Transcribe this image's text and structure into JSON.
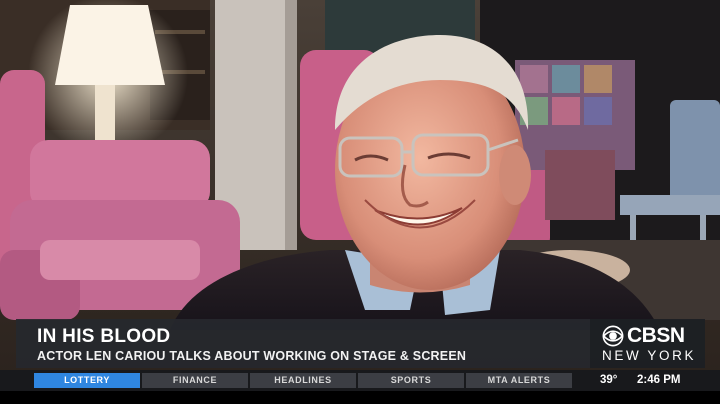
{
  "lower_third": {
    "headline": "IN HIS BLOOD",
    "subhead": "ACTOR LEN CARIOU TALKS ABOUT WORKING ON STAGE & SCREEN"
  },
  "station": {
    "brand": "CBSN",
    "city": "NEW YORK",
    "logo_icon": "cbs-eye-icon"
  },
  "ticker": {
    "tabs": [
      {
        "label": "LOTTERY",
        "active": true
      },
      {
        "label": "FINANCE",
        "active": false
      },
      {
        "label": "HEADLINES",
        "active": false
      },
      {
        "label": "SPORTS",
        "active": false
      },
      {
        "label": "MTA ALERTS",
        "active": false
      }
    ],
    "temperature": "39°",
    "time": "2:46 PM"
  },
  "colors": {
    "accent_blue": "#2f86e0",
    "lower_third_bg": "#26282e",
    "ticker_bg": "#18191c"
  }
}
